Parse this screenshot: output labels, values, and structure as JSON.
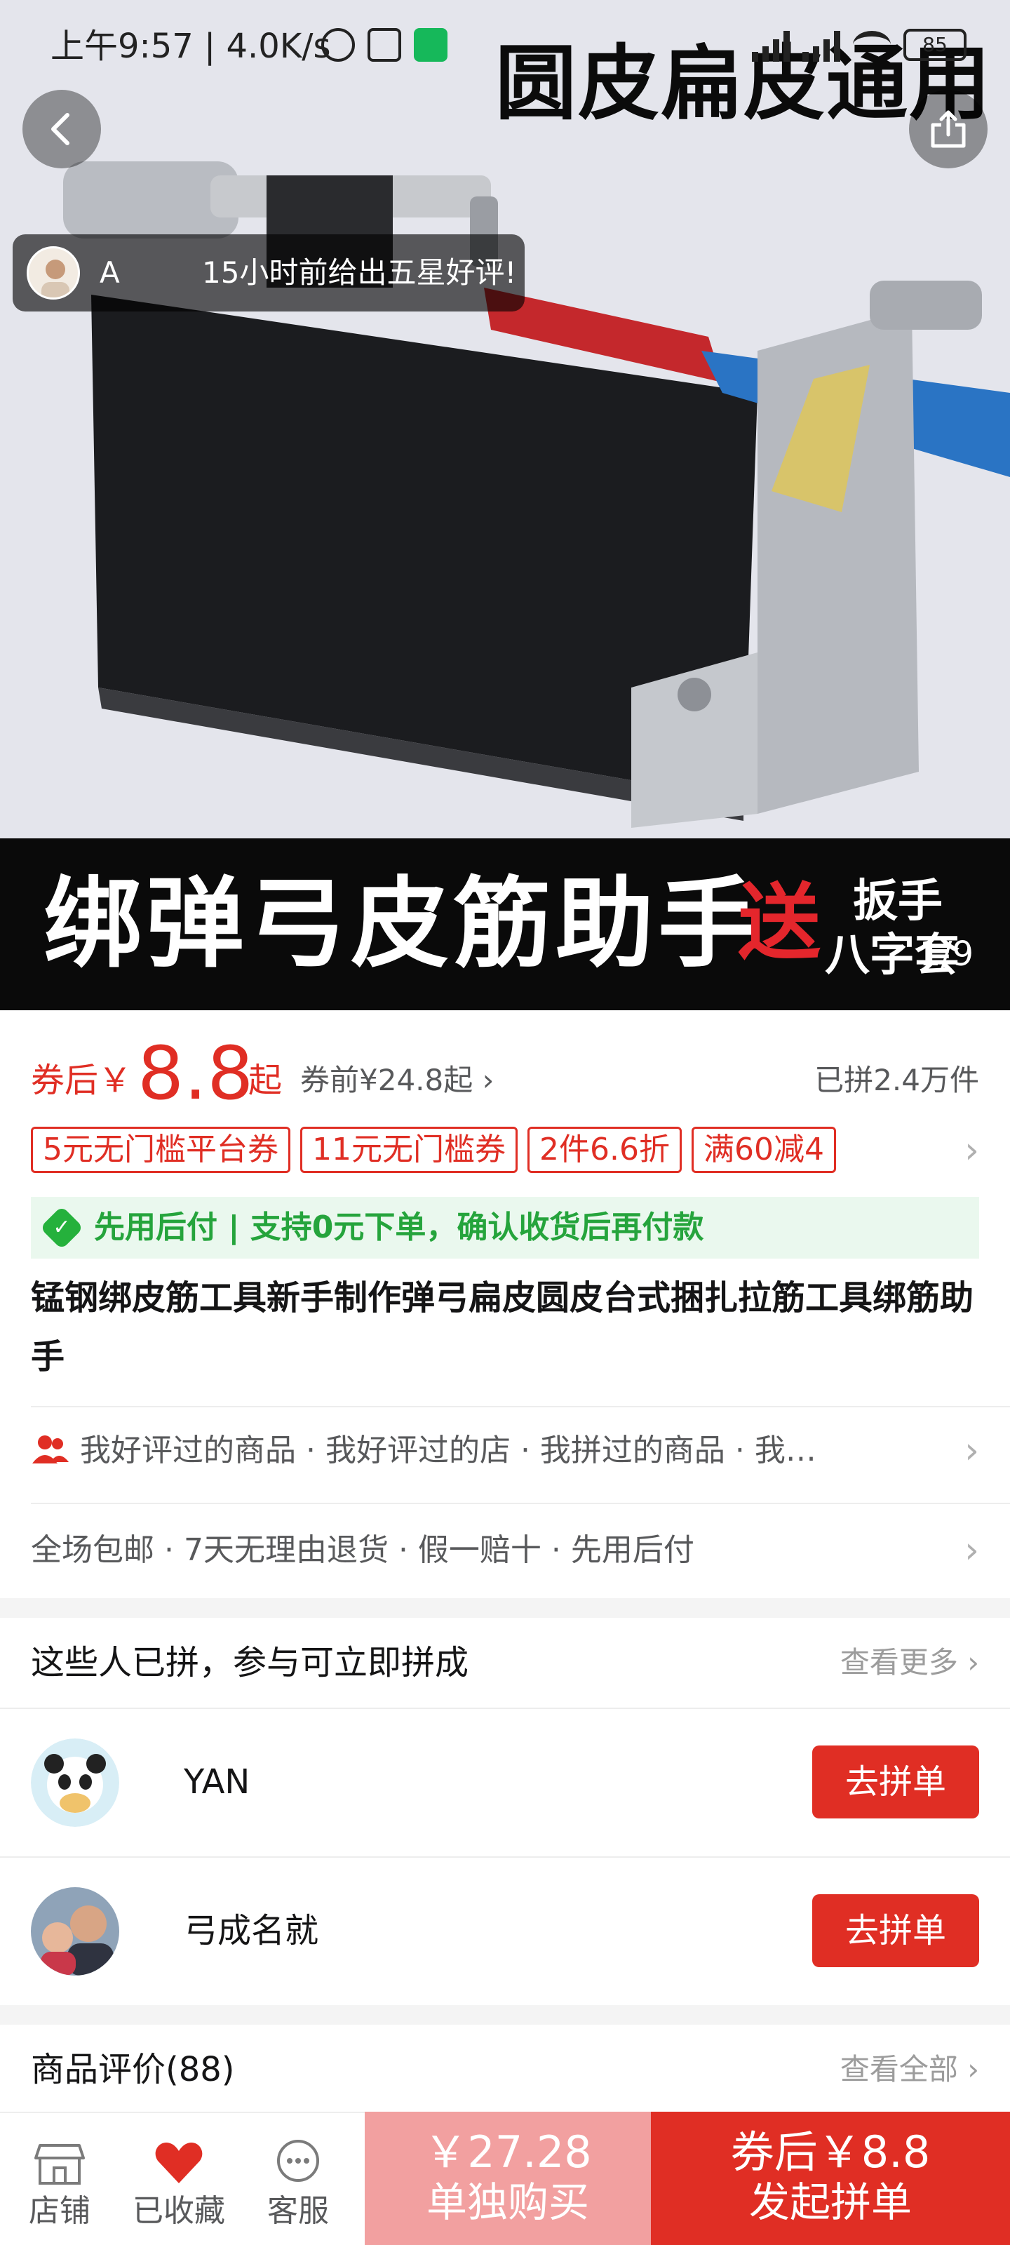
{
  "status_bar": {
    "time": "上午9:57 | 4.0K/s",
    "battery": "85"
  },
  "hero": {
    "overlay_title": "圆皮扁皮通用",
    "banner_main": "绑弹弓皮筋助手",
    "banner_gift": "送",
    "banner_sub1": "扳手",
    "banner_sub2": "八字套",
    "photo_counter": "1/9",
    "review_name": "A",
    "review_text": "15小时前给出五星好评!"
  },
  "price": {
    "prefix": "券后￥",
    "value": "8.8",
    "suffix": "起",
    "before": "券前¥24.8起 ›",
    "sold": "已拼2.4万件"
  },
  "coupons": [
    "5元无门槛平台券",
    "11元无门槛券",
    "2件6.6折",
    "满60减4"
  ],
  "afterpay": {
    "text": "先用后付 | 支持0元下单，确认收货后再付款"
  },
  "product_title": "锰钢绑皮筋工具新手制作弹弓扁皮圆皮台式捆扎拉筋工具绑筋助手",
  "tags_text": "我好评过的商品 · 我好评过的店 · 我拼过的商品 · 我…",
  "services_text": "全场包邮 · 7天无理由退货 · 假一赔十 · 先用后付",
  "group_buy": {
    "title": "这些人已拼，参与可立即拼成",
    "more": "查看更多",
    "users": [
      {
        "name": "YAN",
        "button": "去拼单"
      },
      {
        "name": "弓成名就",
        "button": "去拼单"
      }
    ]
  },
  "reviews": {
    "title": "商品评价(88)",
    "more": "查看全部"
  },
  "bottom_bar": {
    "store": "店铺",
    "favorited": "已收藏",
    "service": "客服",
    "solo_price": "￥27.28",
    "solo_label": "单独购买",
    "group_price": "券后￥8.8",
    "group_label": "发起拼单"
  },
  "colors": {
    "accent_red": "#e02e24",
    "light_red": "#f2a0a0",
    "afterpay_green": "#25a43c"
  }
}
